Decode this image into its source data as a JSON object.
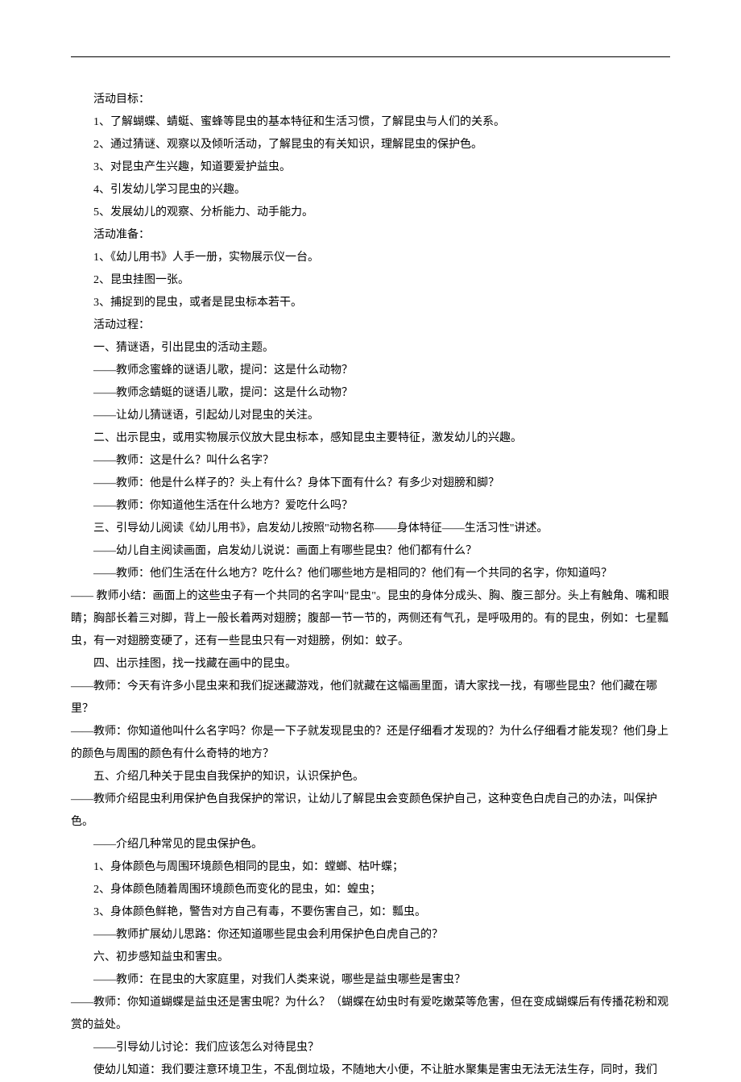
{
  "lines": [
    "活动目标：",
    "1、了解蝴蝶、蜻蜓、蜜蜂等昆虫的基本特征和生活习惯，了解昆虫与人们的关系。",
    "2、通过猜谜、观察以及倾听活动，了解昆虫的有关知识，理解昆虫的保护色。",
    "3、对昆虫产生兴趣，知道要爱护益虫。",
    "4、引发幼儿学习昆虫的兴趣。",
    "5、发展幼儿的观察、分析能力、动手能力。",
    "活动准备：",
    "1、《幼儿用书》人手一册，实物展示仪一台。",
    "2、昆虫挂图一张。",
    "3、捕捉到的昆虫，或者是昆虫标本若干。",
    "活动过程：",
    "一、猜谜语，引出昆虫的活动主题。",
    "——教师念蜜蜂的谜语儿歌，提问：这是什么动物？",
    "——教师念蜻蜓的谜语儿歌，提问：这是什么动物？",
    "——让幼儿猜谜语，引起幼儿对昆虫的关注。",
    "二、出示昆虫，或用实物展示仪放大昆虫标本，感知昆虫主要特征，激发幼儿的兴趣。",
    "——教师：这是什么？叫什么名字？",
    "——教师：他是什么样子的？头上有什么？身体下面有什么？有多少对翅膀和脚？",
    "——教师：你知道他生活在什么地方？爱吃什么吗？",
    "三、引导幼儿阅读《幼儿用书》，启发幼儿按照\"动物名称——身体特征——生活习性\"讲述。",
    "——幼儿自主阅读画面，启发幼儿说说：画面上有哪些昆虫？他们都有什么？",
    "——教师：他们生活在什么地方？吃什么？他们哪些地方是相同的？他们有一个共同的名字，你知道吗？",
    "—— 教师小结：画面上的这些虫子有一个共同的名字叫\"昆虫\"。昆虫的身体分成头、胸、腹三部分。头上有触角、嘴和眼睛；胸部长着三对脚，背上一般长着两对翅膀；腹部一节一节的，两侧还有气孔，是呼吸用的。有的昆虫，例如：七星瓢虫，有一对翅膀变硬了，还有一些昆虫只有一对翅膀，例如：蚊子。",
    "四、出示挂图，找一找藏在画中的昆虫。",
    "——教师：今天有许多小昆虫来和我们捉迷藏游戏，他们就藏在这幅画里面，请大家找一找，有哪些昆虫？他们藏在哪里？",
    "——教师：你知道他叫什么名字吗？你是一下子就发现昆虫的？还是仔细看才发现的？为什么仔细看才能发现？他们身上的颜色与周围的颜色有什么奇特的地方？",
    "五、介绍几种关于昆虫自我保护的知识，认识保护色。",
    "——教师介绍昆虫利用保护色自我保护的常识，让幼儿了解昆虫会变颜色保护自己，这种变色白虎自己的办法，叫保护色。",
    "——介绍几种常见的昆虫保护色。",
    "1、身体颜色与周围环境颜色相同的昆虫，如：螳螂、枯叶蝶；",
    "2、身体颜色随着周围环境颜色而变化的昆虫，如：蝗虫；",
    "3、身体颜色鲜艳，警告对方自己有毒，不要伤害自己，如：瓢虫。",
    "——教师扩展幼儿思路：你还知道哪些昆虫会利用保护色白虎自己的？",
    "六、初步感知益虫和害虫。",
    "——教师：在昆虫的大家庭里，对我们人类来说，哪些是益虫哪些是害虫？",
    "——教师：你知道蝴蝶是益虫还是害虫呢？为什么？（蝴蝶在幼虫时有爱吃嫩菜等危害，但在变成蝴蝶后有传播花粉和观赏的益处。",
    "——引导幼儿讨论：我们应该怎么对待昆虫？",
    "使幼儿知道：我们要注意环境卫生，不乱倒垃圾，不随地大小便，不让脏水聚集是害虫无法无法生存，同时，我们"
  ],
  "noindent_indices": [
    22,
    24,
    25,
    27,
    35
  ]
}
